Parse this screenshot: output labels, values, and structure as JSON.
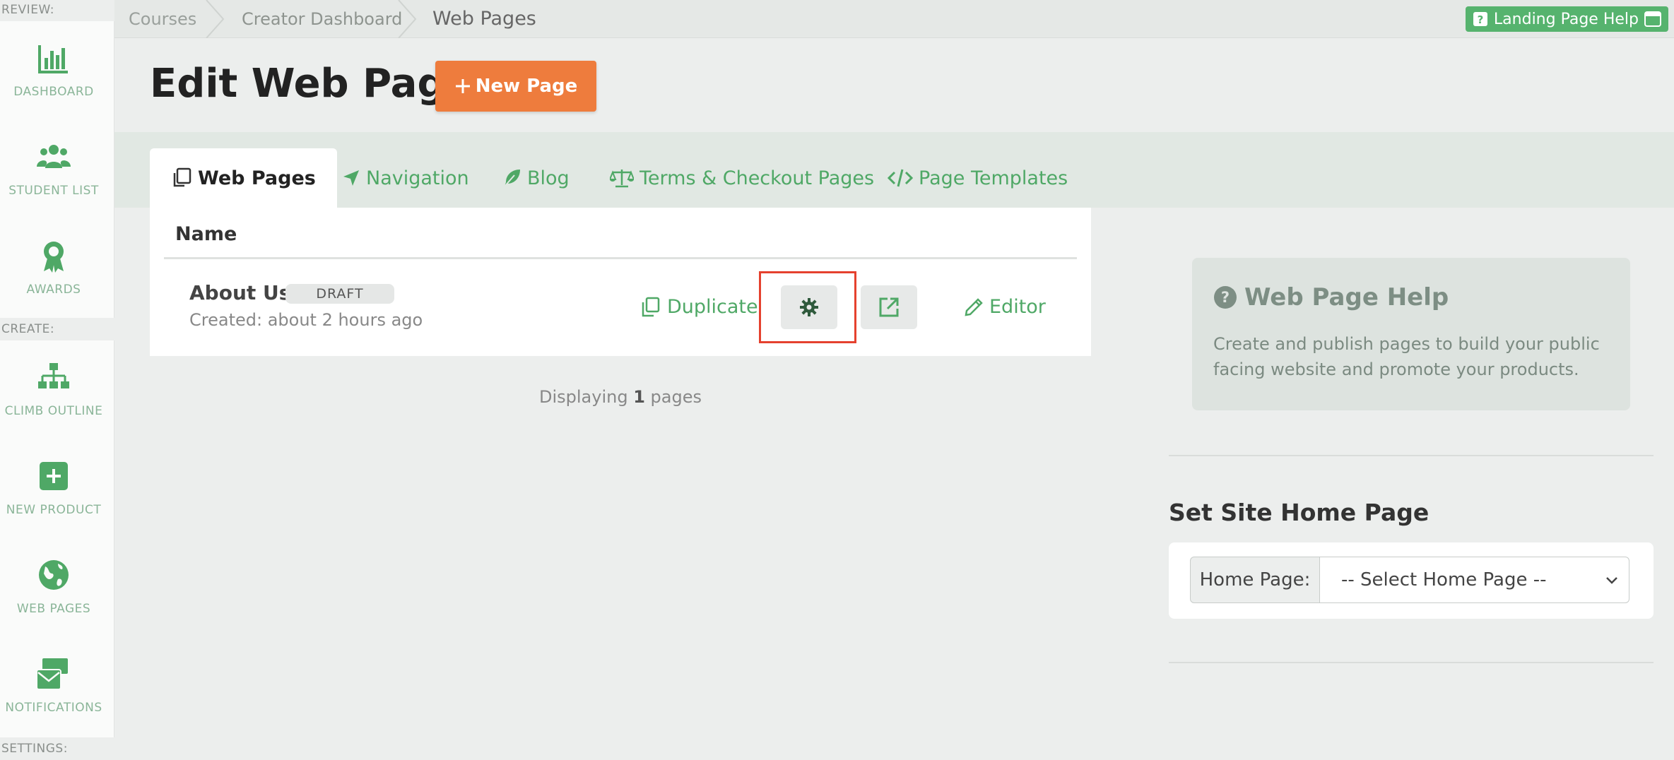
{
  "sidebar": {
    "sections": {
      "review": "REVIEW:",
      "create": "CREATE:",
      "settings": "SETTINGS:"
    },
    "items": [
      {
        "label": "DASHBOARD",
        "icon": "chart-icon"
      },
      {
        "label": "STUDENT LIST",
        "icon": "users-icon"
      },
      {
        "label": "AWARDS",
        "icon": "award-icon"
      },
      {
        "label": "CLIMB OUTLINE",
        "icon": "sitemap-icon"
      },
      {
        "label": "NEW PRODUCT",
        "icon": "plus-square-icon"
      },
      {
        "label": "WEB PAGES",
        "icon": "globe-icon"
      },
      {
        "label": "NOTIFICATIONS",
        "icon": "envelope-icon"
      }
    ]
  },
  "breadcrumb": {
    "items": [
      "Courses",
      "Creator Dashboard",
      "Web Pages"
    ]
  },
  "help_button": {
    "label": "Landing Page Help"
  },
  "header": {
    "title": "Edit Web Pages",
    "new_page_label": "New Page"
  },
  "tabs": [
    {
      "label": "Web Pages",
      "active": true
    },
    {
      "label": "Navigation"
    },
    {
      "label": "Blog"
    },
    {
      "label": "Terms & Checkout Pages"
    },
    {
      "label": "Page Templates"
    }
  ],
  "table": {
    "column": "Name",
    "rows": [
      {
        "title": "About Us",
        "status": "DRAFT",
        "created": "Created: about 2 hours ago",
        "duplicate_label": "Duplicate",
        "editor_label": "Editor"
      }
    ],
    "count_prefix": "Displaying",
    "count": "1",
    "count_suffix": "pages"
  },
  "help_panel": {
    "title": "Web Page Help",
    "text": "Create and publish pages to build your public facing website and promote your products."
  },
  "home_page": {
    "title": "Set Site Home Page",
    "label": "Home Page:",
    "selected": "-- Select Home Page --"
  },
  "colors": {
    "accent_green": "#4fa866",
    "orange": "#ee7c3d",
    "highlight_red": "#e5412e"
  }
}
